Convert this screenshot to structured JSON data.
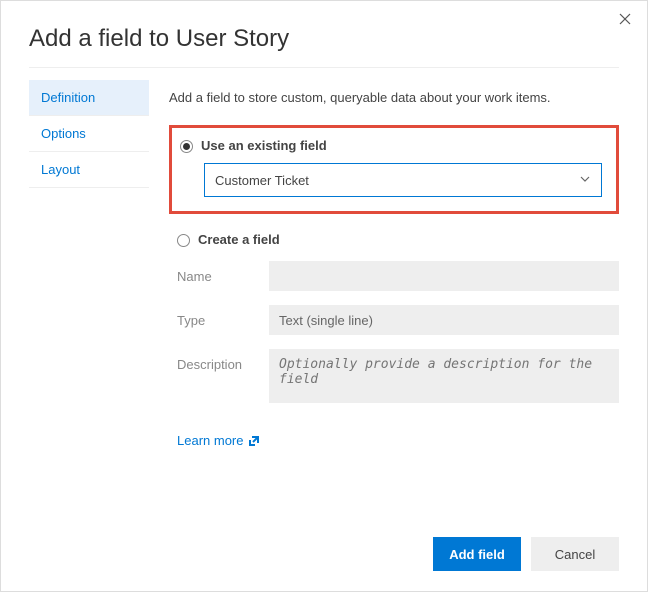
{
  "dialog": {
    "title": "Add a field to User Story"
  },
  "sidebar": {
    "tabs": [
      {
        "label": "Definition"
      },
      {
        "label": "Options"
      },
      {
        "label": "Layout"
      }
    ]
  },
  "content": {
    "intro": "Add a field to store custom, queryable data about your work items.",
    "existing": {
      "radio_label": "Use an existing field",
      "selected_value": "Customer Ticket"
    },
    "create": {
      "radio_label": "Create a field",
      "name_label": "Name",
      "name_value": "",
      "type_label": "Type",
      "type_value": "Text (single line)",
      "description_label": "Description",
      "description_placeholder": "Optionally provide a description for the field"
    },
    "learn_more": "Learn more"
  },
  "footer": {
    "primary": "Add field",
    "secondary": "Cancel"
  }
}
